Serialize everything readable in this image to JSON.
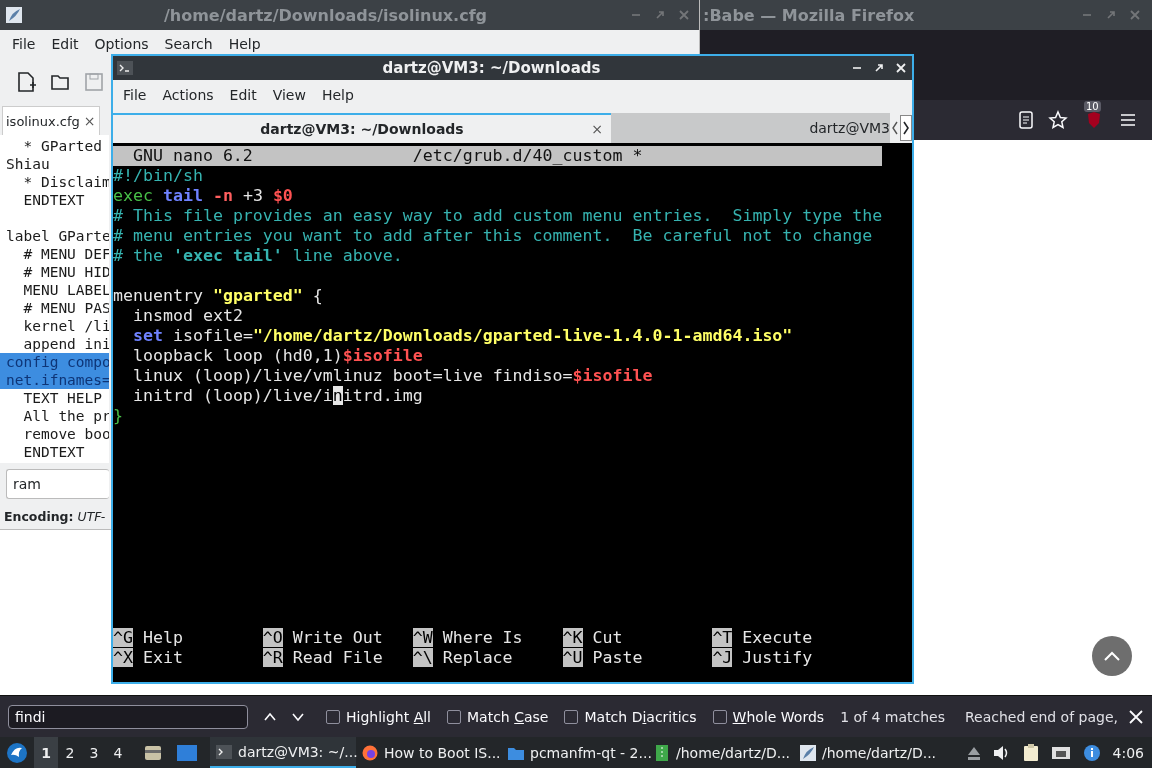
{
  "firefox": {
    "title": ":Babe — Mozilla Firefox",
    "addon_badge": "10"
  },
  "editor": {
    "title": "/home/dartz/Downloads/isolinux.cfg",
    "menu": [
      "File",
      "Edit",
      "Options",
      "Search",
      "Help"
    ],
    "tab": {
      "label": "isolinux.cfg",
      "close": "×"
    },
    "lines": [
      {
        "text": "  * GParted",
        "selected": false
      },
      {
        "text": "Shiau",
        "selected": false
      },
      {
        "text": "  * Disclaim",
        "selected": false
      },
      {
        "text": "  ENDTEXT",
        "selected": false
      },
      {
        "text": "label GParte",
        "selected": false,
        "blank_before": true
      },
      {
        "text": "  # MENU DEF",
        "selected": false
      },
      {
        "text": "  # MENU HID",
        "selected": false
      },
      {
        "text": "  MENU LABEL",
        "selected": false
      },
      {
        "text": "  # MENU PAS",
        "selected": false
      },
      {
        "text": "  kernel /li",
        "selected": false
      },
      {
        "text": "  append ini",
        "selected": false
      },
      {
        "text": "config compo",
        "selected": true
      },
      {
        "text": "net.ifnames=",
        "selected": true
      },
      {
        "text": "  TEXT HELP",
        "selected": false
      },
      {
        "text": "  All the pr",
        "selected": false
      },
      {
        "text": "  remove boo",
        "selected": false
      },
      {
        "text": "  ENDTEXT",
        "selected": false
      }
    ],
    "search": {
      "value": "ram"
    },
    "status": {
      "label": "Encoding:",
      "value": "UTF-"
    }
  },
  "terminal": {
    "title": "dartz@VM3: ~/Downloads",
    "menu": [
      "File",
      "Actions",
      "Edit",
      "View",
      "Help"
    ],
    "tabs": [
      {
        "label": "dartz@VM3: ~/Downloads",
        "close": "×",
        "selected": true
      },
      {
        "label": "dartz@VM3",
        "selected": false
      }
    ],
    "nano": {
      "header_left": "GNU nano 6.2",
      "header_file": "/etc/grub.d/40_custom *",
      "lines": [
        [
          {
            "text": "#!/bin/sh",
            "kind": "comment"
          }
        ],
        [
          {
            "text": "exec",
            "kind": "keyword"
          },
          {
            "text": " tail",
            "kind": "command"
          },
          {
            "text": " -n",
            "kind": "flag"
          },
          {
            "text": " +3 ",
            "kind": "plain"
          },
          {
            "text": "$0",
            "kind": "var"
          }
        ],
        [
          {
            "text": "# This file provides an easy way to add custom menu entries.  Simply type the",
            "kind": "comment"
          }
        ],
        [
          {
            "text": "# menu entries you want to add after this comment.  Be careful not to change",
            "kind": "comment"
          }
        ],
        [
          {
            "text": "# the ",
            "kind": "comment"
          },
          {
            "text": "'exec tail'",
            "kind": "comment_bold"
          },
          {
            "text": " line above.",
            "kind": "comment"
          }
        ],
        [
          {
            "text": "menuentry ",
            "kind": "plain",
            "blank_before": true
          },
          {
            "text": "\"gparted\"",
            "kind": "string"
          },
          {
            "text": " {",
            "kind": "plain"
          }
        ],
        [
          {
            "text": "  insmod ext2",
            "kind": "plain"
          }
        ],
        [
          {
            "text": "  set",
            "kind": "command"
          },
          {
            "text": " isofile=",
            "kind": "plain"
          },
          {
            "text": "\"/home/dartz/Downloads/gparted-live-1.4.0-1-amd64.iso\"",
            "kind": "string"
          }
        ],
        [
          {
            "text": "  loopback loop (hd0,1)",
            "kind": "plain"
          },
          {
            "text": "$isofile",
            "kind": "var"
          }
        ],
        [
          {
            "text": "  linux (loop)/live/vmlinuz boot=live findiso=",
            "kind": "plain"
          },
          {
            "text": "$isofile",
            "kind": "var"
          }
        ],
        [
          {
            "text": "  initrd (loop)/live/i",
            "kind": "plain"
          },
          {
            "text": "n",
            "kind": "cursor"
          },
          {
            "text": "itrd.img",
            "kind": "plain"
          }
        ],
        [
          {
            "text": "}",
            "kind": "keyword"
          }
        ]
      ],
      "shortcuts": [
        [
          {
            "key": "^G",
            "label": "Help"
          },
          {
            "key": "^O",
            "label": "Write Out"
          },
          {
            "key": "^W",
            "label": "Where Is"
          },
          {
            "key": "^K",
            "label": "Cut"
          },
          {
            "key": "^T",
            "label": "Execute"
          }
        ],
        [
          {
            "key": "^X",
            "label": "Exit"
          },
          {
            "key": "^R",
            "label": "Read File"
          },
          {
            "key": "^\\",
            "label": "Replace"
          },
          {
            "key": "^U",
            "label": "Paste"
          },
          {
            "key": "^J",
            "label": "Justify"
          }
        ]
      ]
    }
  },
  "find_bar": {
    "value": "findi",
    "options": [
      {
        "label": {
          "before": "Highlight ",
          "key": "A",
          "after": "ll"
        },
        "checked": false
      },
      {
        "label": {
          "before": "Match ",
          "key": "C",
          "after": "ase"
        },
        "checked": false
      },
      {
        "label": {
          "before": "Match D",
          "key": "i",
          "after": "acritics"
        },
        "checked": false
      },
      {
        "label": {
          "key": "W",
          "after": "hole Words"
        },
        "checked": false
      }
    ],
    "matches": "1 of 4 matches",
    "status": "Reached end of page,"
  },
  "taskbar": {
    "desktops": [
      {
        "label": "1",
        "selected": true
      },
      {
        "label": "2",
        "selected": false
      },
      {
        "label": "3",
        "selected": false
      },
      {
        "label": "4",
        "selected": false
      }
    ],
    "tasks": [
      {
        "label": "dartz@VM3: ~/...",
        "kind": "terminal",
        "selected": true
      },
      {
        "label": "How to Boot IS...",
        "kind": "browser",
        "selected": false
      },
      {
        "label": "pcmanfm-qt - 2...",
        "kind": "folder",
        "selected": false
      },
      {
        "label": "/home/dartz/D...",
        "kind": "archive",
        "selected": false
      },
      {
        "label": "/home/dartz/D...",
        "kind": "editor",
        "selected": false
      }
    ],
    "clock": "4:06"
  }
}
